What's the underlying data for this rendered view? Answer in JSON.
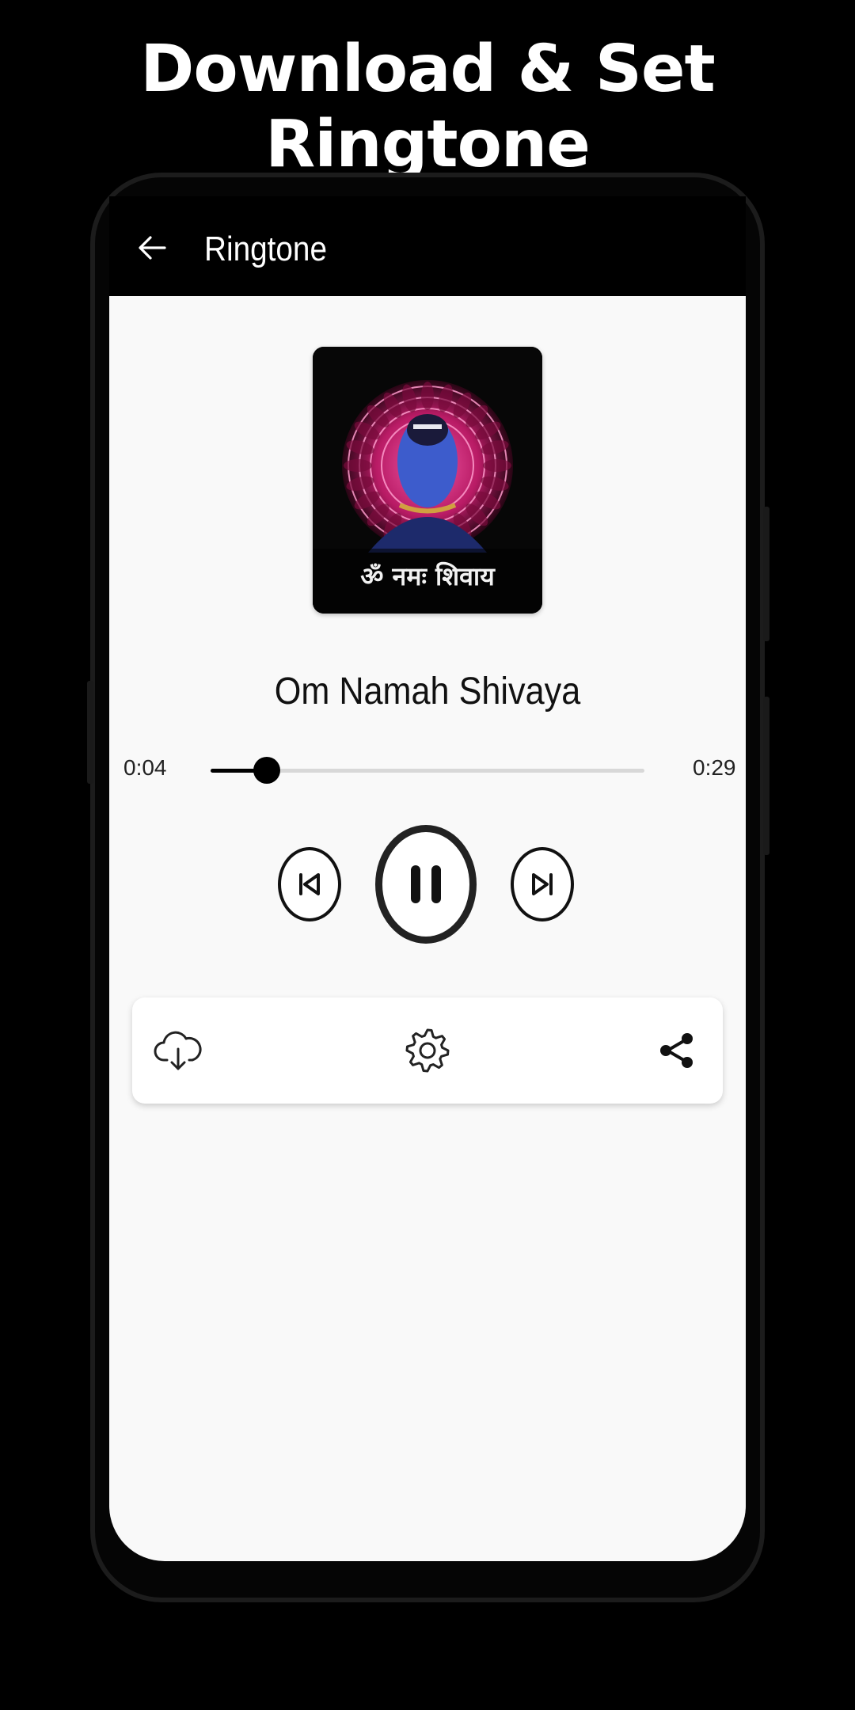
{
  "promo": {
    "title": "Download & Set Ringtone"
  },
  "appbar": {
    "title": "Ringtone",
    "back_icon": "arrow-left-icon"
  },
  "artwork": {
    "caption": "ॐ नमः शिवाय"
  },
  "player": {
    "song_title": "Om Namah Shivaya",
    "current_time": "0:04",
    "total_time": "0:29",
    "progress_fraction": 0.13,
    "state": "playing"
  },
  "controls": {
    "previous_icon": "skip-previous-icon",
    "pause_icon": "pause-icon",
    "next_icon": "skip-next-icon"
  },
  "actions": [
    {
      "name": "download",
      "icon": "cloud-download-icon"
    },
    {
      "name": "settings",
      "icon": "gear-icon"
    },
    {
      "name": "share",
      "icon": "share-icon"
    }
  ],
  "colors": {
    "background": "#000000",
    "screen": "#f9f9f9",
    "accent": "#000000",
    "mandala": "#e0307e"
  }
}
